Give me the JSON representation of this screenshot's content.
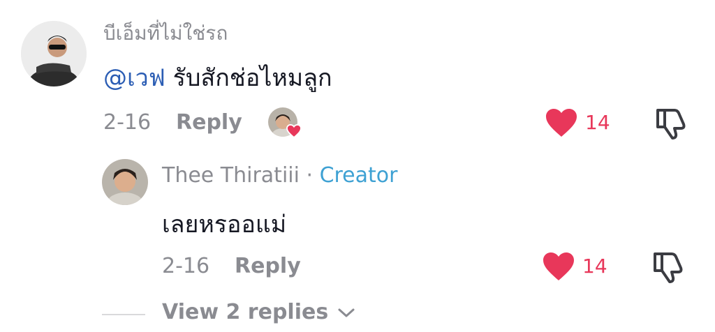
{
  "comment": {
    "username": "บีเอ็มที่ไม่ใช่รถ",
    "mention": "@เวฟ",
    "text": " รับสักช่อไหมลูก",
    "date": "2-16",
    "reply_label": "Reply",
    "likes": "14"
  },
  "reply": {
    "username": "Thee Thiratiii",
    "separator": " · ",
    "creator_label": "Creator",
    "text": "เลยหรออแม่",
    "date": "2-16",
    "reply_label": "Reply",
    "likes": "14"
  },
  "view_replies_label": "View 2 replies",
  "colors": {
    "like_red": "#e8375a",
    "mention_blue": "#2b5db4",
    "creator_blue": "#3ea1d3",
    "muted_gray": "#8a8b91"
  }
}
